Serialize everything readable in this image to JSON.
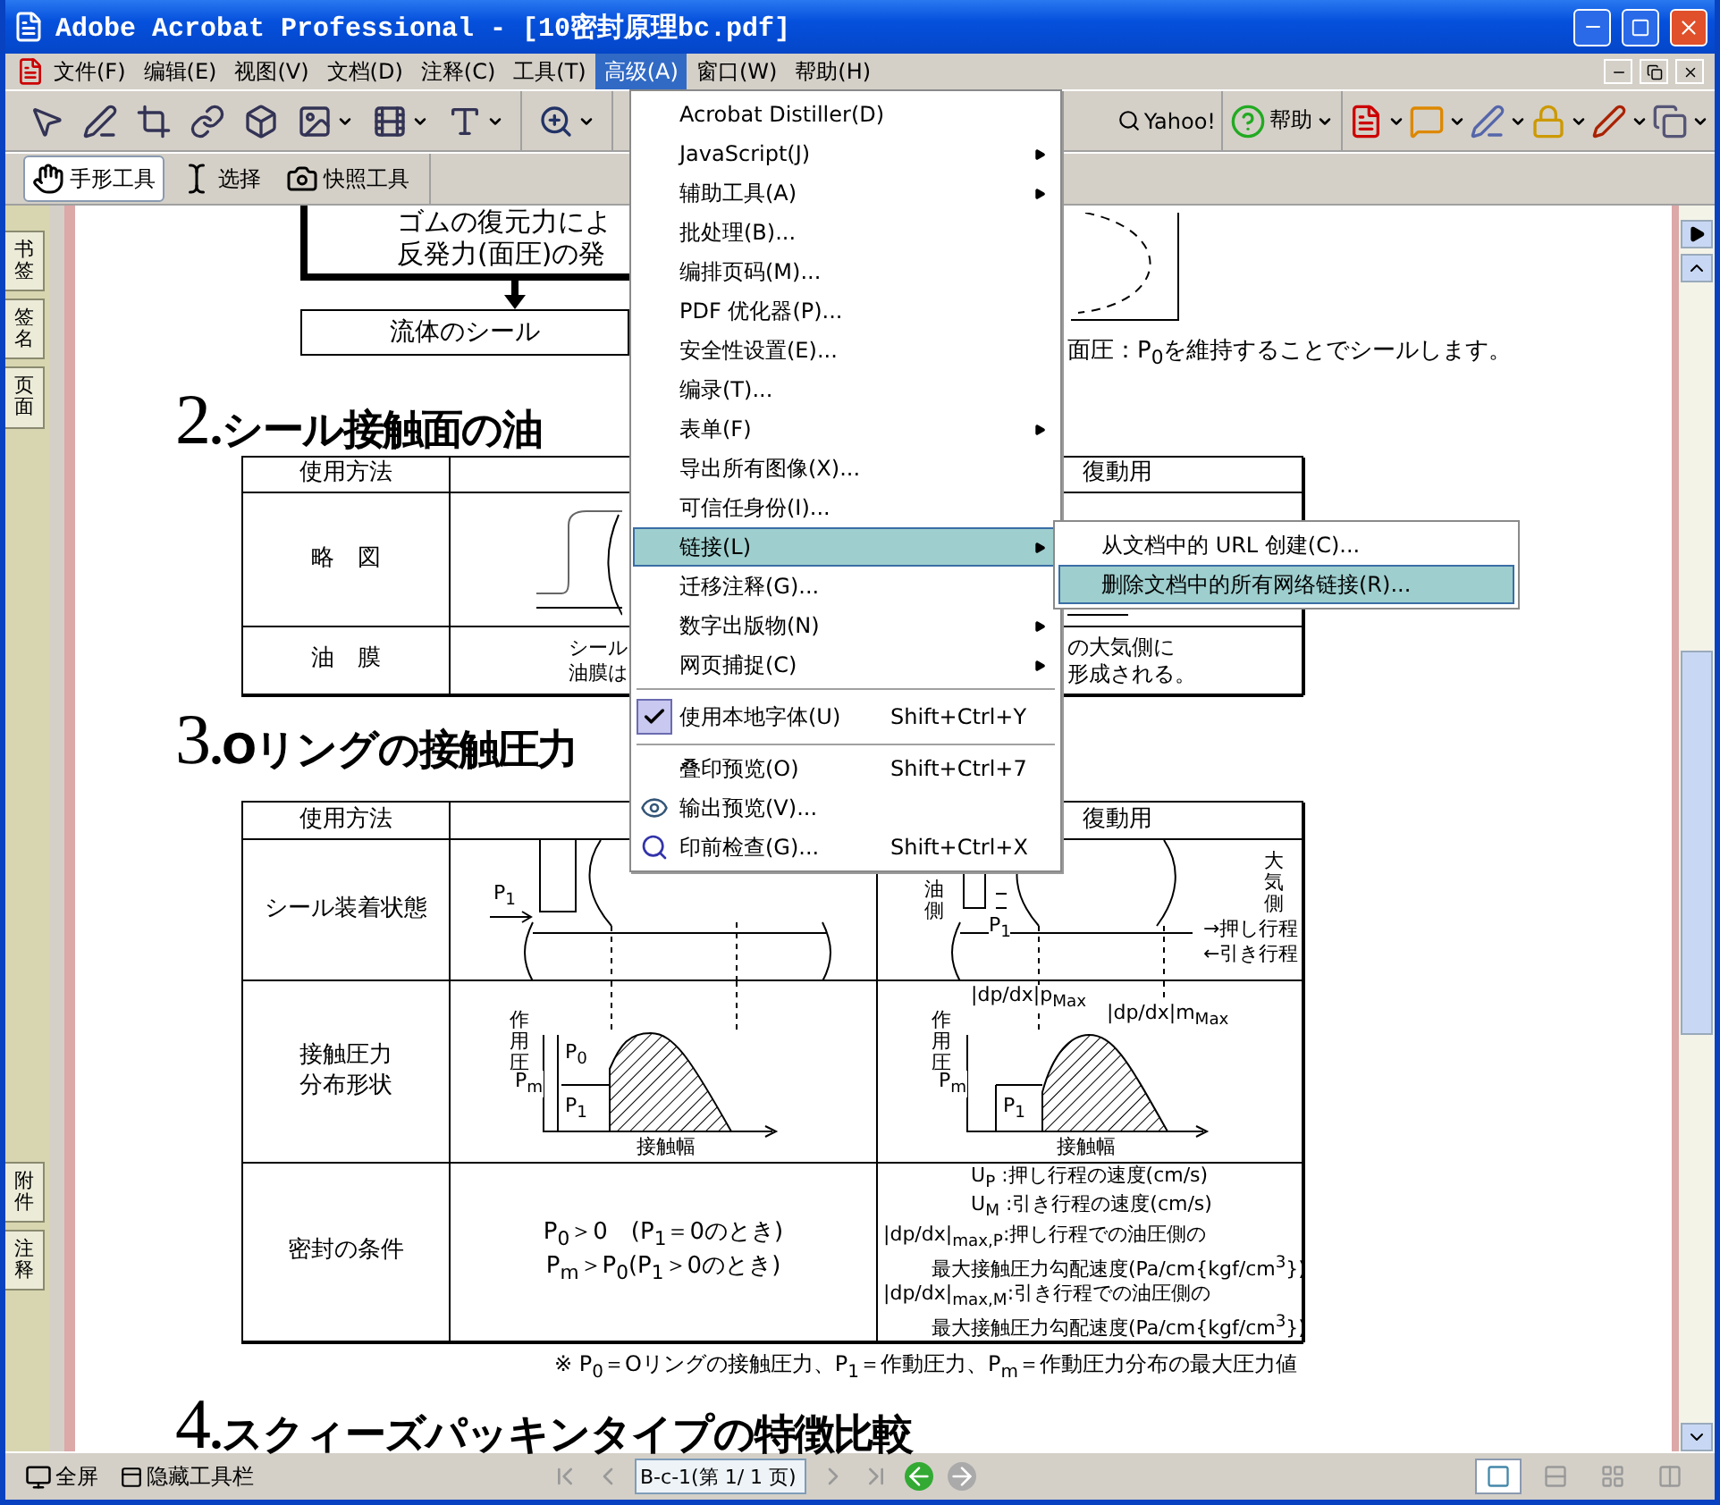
{
  "window": {
    "title": "Adobe Acrobat Professional - [10密封原理bc.pdf]"
  },
  "menu_bar": {
    "items": [
      {
        "label": "文件(F)",
        "selected": false
      },
      {
        "label": "编辑(E)",
        "selected": false
      },
      {
        "label": "视图(V)",
        "selected": false
      },
      {
        "label": "文档(D)",
        "selected": false
      },
      {
        "label": "注释(C)",
        "selected": false
      },
      {
        "label": "工具(T)",
        "selected": false
      },
      {
        "label": "高级(A)",
        "selected": true
      },
      {
        "label": "窗口(W)",
        "selected": false
      },
      {
        "label": "帮助(H)",
        "selected": false
      }
    ]
  },
  "toolbar": {
    "search_label": "Yahoo!",
    "help_label": "帮助"
  },
  "tools": [
    {
      "label": "手形工具",
      "selected": true
    },
    {
      "label": "选择",
      "selected": false
    },
    {
      "label": "快照工具",
      "selected": false
    }
  ],
  "side_tabs": {
    "top": [
      "书签",
      "签名",
      "页面"
    ],
    "bottom": [
      "附件",
      "注释"
    ]
  },
  "document": {
    "top_box_lines": [
      "ゴムの復元力によ",
      "反発力(面圧)の発"
    ],
    "result": "流体のシール",
    "note": "面圧：P$_{0}$を維持することでシールします。",
    "section_2": {
      "number": "2.",
      "title": "シール接触面の油",
      "header": [
        "使用方法",
        "復動用"
      ],
      "sketch_label": "略　図",
      "film_label": "油　膜",
      "film_middle": [
        "シール",
        "油膜は"
      ],
      "film_right": [
        "の大気側に",
        "形成される。"
      ]
    },
    "section_3": {
      "number": "3.",
      "title": "Oリングの接触圧力",
      "header": [
        "使用方法",
        "復動用"
      ],
      "mount": {
        "label": "シール装着状態",
        "left_labels": [
          "P$_{1}$"
        ],
        "right_labels": [
          "油側",
          "P$_{1}$",
          "大気側",
          "→押し行程",
          "←引き行程"
        ]
      },
      "pressure": {
        "label_lines": [
          "接触圧力",
          "分布形状"
        ],
        "left_labels": [
          "作用圧",
          "P$_{0}$",
          "P$_{m}$",
          "P$_{1}$",
          "接触幅"
        ],
        "right_labels": [
          "作用圧",
          "|dp/dx|p$_{Max}$",
          "|dp/dx|m$_{Max}$",
          "P$_{m}$",
          "P$_{1}$",
          "接触幅"
        ]
      },
      "condition": {
        "label": "密封の条件",
        "left_lines": [
          "P$_{0}$＞0　(P$_{1}$＝0のとき)",
          "P$_{m}$＞P$_{0}$(P$_{1}$＞0のとき)"
        ],
        "right_lines": [
          "U$_{P}$ :押し行程の速度(cm/s)",
          "U$_{M}$ :引き行程の速度(cm/s)",
          "|dp/dx|$_{max,P}$:押し行程での油圧側の",
          "最大接触圧力勾配速度(Pa/cm{kgf/cm$^{3}$})",
          "|dp/dx|$_{max,M}$:引き行程での油圧側の",
          "最大接触圧力勾配速度(Pa/cm{kgf/cm$^{3}$})"
        ]
      },
      "footnote": "※ P$_{0}$＝Oリングの接触圧力、P$_{1}$＝作動圧力、P$_{m}$＝作動圧力分布の最大圧力値"
    },
    "section_4": {
      "number": "4.",
      "title": "スクィーズパッキンタイプの特徴比較"
    }
  },
  "menu": {
    "items": [
      {
        "kind": "item",
        "label": "Acrobat Distiller(D)",
        "submenu": false,
        "checked": false,
        "selected": false
      },
      {
        "kind": "item",
        "label": "JavaScript(J)",
        "submenu": true,
        "checked": false,
        "selected": false
      },
      {
        "kind": "item",
        "label": "辅助工具(A)",
        "submenu": true,
        "checked": false,
        "selected": false
      },
      {
        "kind": "item",
        "label": "批处理(B)...",
        "submenu": false,
        "checked": false,
        "selected": false
      },
      {
        "kind": "item",
        "label": "编排页码(M)...",
        "submenu": false,
        "checked": false,
        "selected": false
      },
      {
        "kind": "item",
        "label": "PDF 优化器(P)...",
        "submenu": false,
        "checked": false,
        "selected": false
      },
      {
        "kind": "item",
        "label": "安全性设置(E)...",
        "submenu": false,
        "checked": false,
        "selected": false
      },
      {
        "kind": "item",
        "label": "编录(T)...",
        "submenu": false,
        "checked": false,
        "selected": false
      },
      {
        "kind": "item",
        "label": "表单(F)",
        "submenu": true,
        "checked": false,
        "selected": false
      },
      {
        "kind": "item",
        "label": "导出所有图像(X)...",
        "submenu": false,
        "checked": false,
        "selected": false
      },
      {
        "kind": "item",
        "label": "可信任身份(I)...",
        "submenu": false,
        "checked": false,
        "selected": false
      },
      {
        "kind": "item",
        "label": "链接(L)",
        "submenu": true,
        "checked": false,
        "selected": true
      },
      {
        "kind": "item",
        "label": "迁移注释(G)...",
        "submenu": false,
        "checked": false,
        "selected": false
      },
      {
        "kind": "item",
        "label": "数字出版物(N)",
        "submenu": true,
        "checked": false,
        "selected": false
      },
      {
        "kind": "item",
        "label": "网页捕捉(C)",
        "submenu": true,
        "checked": false,
        "selected": false
      },
      {
        "kind": "separator"
      },
      {
        "kind": "item",
        "label": "使用本地字体(U)",
        "shortcut": "Shift+Ctrl+Y",
        "submenu": false,
        "checked": true,
        "selected": false
      },
      {
        "kind": "separator"
      },
      {
        "kind": "item",
        "label": "叠印预览(O)",
        "shortcut": "Shift+Ctrl+7",
        "submenu": false,
        "checked": false,
        "selected": false
      },
      {
        "kind": "preview",
        "label": "输出预览(V)...",
        "submenu": false,
        "checked": false,
        "selected": false
      },
      {
        "kind": "preflight",
        "label": "印前检查(G)...",
        "shortcut": "Shift+Ctrl+X",
        "submenu": false,
        "checked": false,
        "selected": false
      }
    ]
  },
  "submenu": {
    "items": [
      {
        "label": "从文档中的 URL 创建(C)...",
        "selected": false
      },
      {
        "label": "删除文档中的所有网络链接(R)...",
        "selected": true
      }
    ]
  },
  "status_bar": {
    "full_screen": "全屏",
    "hide_toolbars": "隐藏工具栏",
    "page_field": "B-c-1(第 1/ 1 页)",
    "view_modes": [
      {
        "selected": true
      },
      {
        "selected": false
      },
      {
        "selected": false
      },
      {
        "selected": false
      }
    ]
  }
}
